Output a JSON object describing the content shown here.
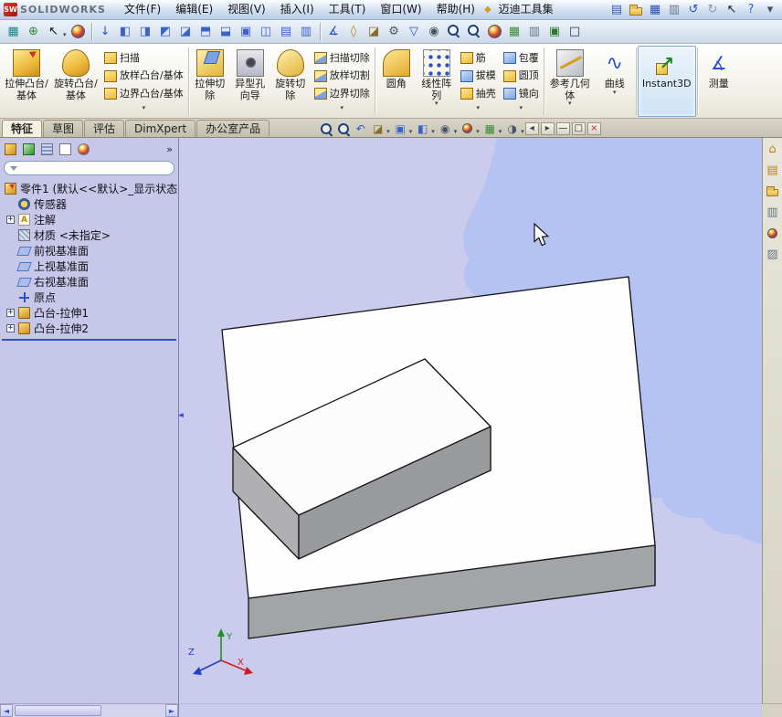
{
  "colors": {
    "viewport_background": "#cbcbee",
    "background_blob": "#b5c3f3",
    "panel_background": "#c7c7e9",
    "instant3d_active": "#cfe3f5",
    "close_red": "#c82232",
    "logo_red": "#c81e14",
    "model_top_face": "#fdfdfd",
    "model_side_face": "#8e8f90"
  },
  "titlebar": {
    "logo_badge": "SW",
    "logo_text": "SOLIDWORKS",
    "menus": [
      "文件(F)",
      "编辑(E)",
      "视图(V)",
      "插入(I)",
      "工具(T)",
      "窗口(W)",
      "帮助(H)",
      "迈迪工具集"
    ],
    "maidi_icon_glyph": "◆",
    "quick_icons": [
      {
        "name": "new-document-icon",
        "glyph": "▤",
        "color": "#3a5fb0"
      },
      {
        "name": "open-folder-icon",
        "cls": "folder"
      },
      {
        "name": "save-icon",
        "glyph": "▦",
        "color": "#2a52b4"
      },
      {
        "name": "print-icon",
        "glyph": "▥",
        "color": "#667788"
      },
      {
        "name": "undo-icon",
        "glyph": "↺",
        "color": "#2a52c8"
      },
      {
        "name": "redo-icon",
        "glyph": "↻",
        "color": "#8899aa"
      },
      {
        "name": "select-cursor-icon",
        "glyph": "↖",
        "color": "#222222"
      },
      {
        "name": "help-icon",
        "glyph": "?",
        "color": "#1a6ad4"
      },
      {
        "name": "expand-toolbar-icon",
        "glyph": "▾",
        "color": "#445566"
      }
    ]
  },
  "toolbar2": {
    "left_icons": [
      {
        "name": "sketch-grid-icon",
        "glyph": "▦",
        "color": "#1a8a8a"
      },
      {
        "name": "reference-axes-icon",
        "glyph": "⊕",
        "color": "#2a8a2a"
      },
      {
        "name": "select-arrow-icon",
        "glyph": "↖",
        "color": "#111111",
        "dd": true
      },
      {
        "name": "rebuild-icon",
        "cls": "sphere"
      }
    ],
    "view_icons": [
      {
        "name": "arrow-down-icon",
        "glyph": "↓",
        "color": "#2a52c8"
      },
      {
        "name": "front-view-icon",
        "glyph": "◧",
        "color": "#3a62c8"
      },
      {
        "name": "back-view-icon",
        "glyph": "◨",
        "color": "#3a62c8"
      },
      {
        "name": "left-view-icon",
        "glyph": "◩",
        "color": "#3a62c8"
      },
      {
        "name": "right-view-icon",
        "glyph": "◪",
        "color": "#3a62c8"
      },
      {
        "name": "top-view-icon",
        "glyph": "⬒",
        "color": "#3a62c8"
      },
      {
        "name": "bottom-view-icon",
        "glyph": "⬓",
        "color": "#3a62c8"
      },
      {
        "name": "isometric-view-icon",
        "glyph": "▣",
        "color": "#3a62c8"
      },
      {
        "name": "dimetric-view-icon",
        "glyph": "◫",
        "color": "#3a62c8"
      },
      {
        "name": "trimetric-view-icon",
        "glyph": "▤",
        "color": "#3a62c8"
      },
      {
        "name": "normal-to-view-icon",
        "glyph": "▥",
        "color": "#3a62c8"
      }
    ],
    "tool_icons": [
      {
        "name": "measure-icon",
        "glyph": "∡",
        "color": "#2a52c8"
      },
      {
        "name": "mass-properties-icon",
        "glyph": "◊",
        "color": "#b8860b"
      },
      {
        "name": "section-properties-icon",
        "glyph": "◪",
        "color": "#8a6a2a"
      },
      {
        "name": "options-gear-icon",
        "glyph": "⚙",
        "color": "#555555"
      },
      {
        "name": "selection-filter-icon",
        "glyph": "▽",
        "color": "#2a52c8"
      },
      {
        "name": "hide-show-icon",
        "glyph": "◉",
        "color": "#445566"
      },
      {
        "name": "zoom-icon",
        "cls": "mag"
      },
      {
        "name": "search-icon",
        "cls": "mag"
      },
      {
        "name": "appearance-icon",
        "cls": "sphere"
      },
      {
        "name": "scene-icon",
        "glyph": "▦",
        "color": "#3a8a3a"
      },
      {
        "name": "task-pane-icon",
        "glyph": "▥",
        "color": "#667788"
      },
      {
        "name": "capture-icon",
        "glyph": "▣",
        "color": "#2a7a2a"
      },
      {
        "name": "fullscreen-icon",
        "glyph": "□",
        "color": "#333333"
      }
    ]
  },
  "ribbon": {
    "g1": {
      "b1": "拉伸凸台/基体",
      "b2": "旋转凸台/基体",
      "s1": "扫描",
      "s2": "放样凸台/基体",
      "s3": "边界凸台/基体"
    },
    "g2": {
      "b1": "拉伸切除",
      "b2": "异型孔向导",
      "b3": "旋转切除",
      "s1": "扫描切除",
      "s2": "放样切割",
      "s3": "边界切除"
    },
    "g3": {
      "b1": "圆角",
      "b2": "线性阵列",
      "s1": "筋",
      "s2": "拔模",
      "s3": "抽壳",
      "t1": "包覆",
      "t2": "圆顶",
      "t3": "镜向"
    },
    "g4": {
      "b1": "参考几何体",
      "b2": "曲线"
    },
    "g5": {
      "b1": "Instant3D"
    },
    "g6": {
      "b1": "测量"
    },
    "dropdown_glyph": "▾"
  },
  "tabs_row": {
    "tabs": [
      "特征",
      "草图",
      "评估",
      "DimXpert",
      "办公室产品"
    ],
    "headsup_icons": [
      {
        "name": "zoom-fit-icon",
        "cls": "mag"
      },
      {
        "name": "zoom-area-icon",
        "cls": "mag"
      },
      {
        "name": "previous-view-icon",
        "glyph": "↶",
        "color": "#2a52c8"
      },
      {
        "name": "section-view-icon",
        "glyph": "◪",
        "color": "#8a6a2a",
        "dd": true
      },
      {
        "name": "view-orientation-icon",
        "glyph": "▣",
        "color": "#3a62c8",
        "dd": true
      },
      {
        "name": "display-style-icon",
        "glyph": "◧",
        "color": "#3a62c8",
        "dd": true
      },
      {
        "name": "hide-show-items-icon",
        "glyph": "◉",
        "color": "#445566",
        "dd": true
      },
      {
        "name": "edit-appearance-icon",
        "cls": "sphere",
        "dd": true
      },
      {
        "name": "apply-scene-icon",
        "glyph": "▦",
        "color": "#3a8a3a",
        "dd": true
      },
      {
        "name": "view-settings-icon",
        "glyph": "◑",
        "color": "#445566",
        "dd": true
      }
    ],
    "window_controls": [
      {
        "name": "pane-collapse-left-icon",
        "glyph": "◂",
        "color": "#334455"
      },
      {
        "name": "pane-expand-right-icon",
        "glyph": "▸",
        "color": "#334455"
      },
      {
        "name": "minimize-icon",
        "glyph": "—",
        "color": "#222222"
      },
      {
        "name": "restore-icon",
        "glyph": "□",
        "color": "#222222"
      },
      {
        "name": "close-icon",
        "glyph": "×",
        "color": "#c82232"
      }
    ]
  },
  "panel": {
    "tabs": [
      {
        "name": "featuremanager-tab-icon",
        "cls": "pm pm1"
      },
      {
        "name": "propertymanager-tab-icon",
        "cls": "pm pm2"
      },
      {
        "name": "configurationmanager-tab-icon",
        "cls": "pm pm3"
      },
      {
        "name": "dimxpertmanager-tab-icon",
        "cls": "pm pm4"
      },
      {
        "name": "displaymanager-tab-icon",
        "cls": "pm pm5"
      }
    ],
    "chevron": "»",
    "filter_placeholder": "",
    "tree": {
      "root_label": "零件1 (默认<<默认>_显示状态",
      "items": [
        {
          "label": "传感器"
        },
        {
          "label": "注解",
          "expand": "+"
        },
        {
          "label": "材质 <未指定>"
        },
        {
          "label": "前视基准面"
        },
        {
          "label": "上视基准面"
        },
        {
          "label": "右视基准面"
        },
        {
          "label": "原点"
        },
        {
          "label": "凸台-拉伸1",
          "expand": "+"
        },
        {
          "label": "凸台-拉伸2",
          "expand": "+"
        }
      ]
    }
  },
  "taskpane": {
    "icons": [
      {
        "name": "solidworks-resources-icon",
        "glyph": "⌂",
        "color": "#b8860b"
      },
      {
        "name": "design-library-icon",
        "glyph": "▤",
        "color": "#b8860b"
      },
      {
        "name": "file-explorer-icon",
        "cls": "folder"
      },
      {
        "name": "view-palette-icon",
        "glyph": "▥",
        "color": "#667788"
      },
      {
        "name": "appearances-icon",
        "cls": "sphere"
      },
      {
        "name": "custom-properties-icon",
        "glyph": "▨",
        "color": "#667788"
      }
    ]
  },
  "viewport": {
    "triad": {
      "x": "X",
      "y": "Y",
      "z": "Z"
    }
  },
  "scrollbar": {
    "left_arrow": "◄",
    "right_arrow": "►"
  }
}
